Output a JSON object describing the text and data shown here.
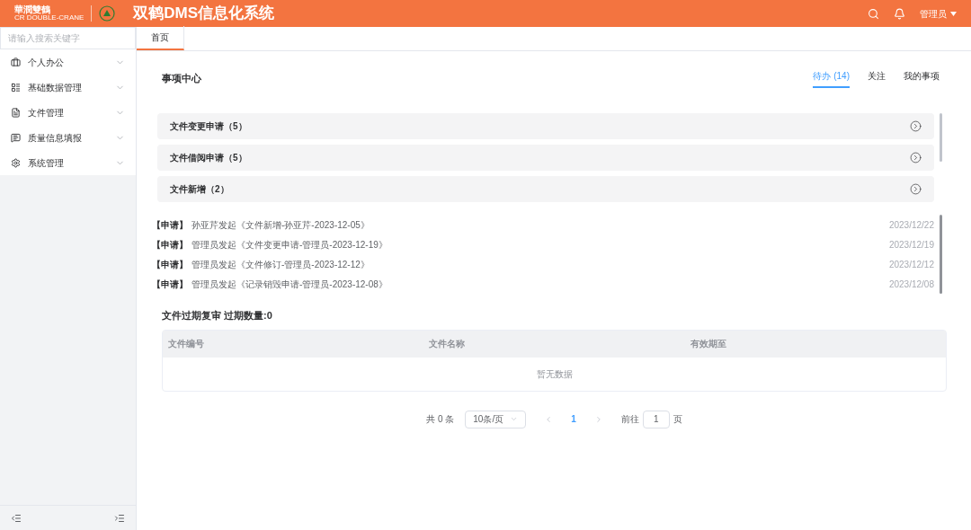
{
  "header": {
    "logo_text": "華潤雙鶴",
    "logo_subtext": "CR DOUBLE-CRANE",
    "title": "双鹤DMS信息化系统",
    "user": "管理员"
  },
  "sidebar": {
    "search": {
      "placeholder": "请输入搜索关键字"
    },
    "items": [
      {
        "label": "个人办公",
        "expanded": false
      },
      {
        "label": "基础数据管理",
        "expanded": false
      },
      {
        "label": "文件管理",
        "expanded": false
      },
      {
        "label": "质量信息填报",
        "expanded": false
      },
      {
        "label": "系统管理",
        "expanded": false
      }
    ]
  },
  "page_tabs": [
    {
      "label": "首页",
      "selected": true
    }
  ],
  "task_center": {
    "title": "事项中心",
    "tabs": [
      {
        "label": "待办 (14)",
        "selected": true
      },
      {
        "label": "关注",
        "selected": false
      },
      {
        "label": "我的事项",
        "selected": false
      }
    ],
    "groups": [
      {
        "label": "文件变更申请（5）"
      },
      {
        "label": "文件借阅申请（5）"
      },
      {
        "label": "文件新增（2）"
      }
    ],
    "items": [
      {
        "tag": "【申请】",
        "text": "孙亚芹发起《文件新增-孙亚芹-2023-12-05》",
        "date": "2023/12/22"
      },
      {
        "tag": "【申请】",
        "text": "管理员发起《文件变更申请-管理员-2023-12-19》",
        "date": "2023/12/19"
      },
      {
        "tag": "【申请】",
        "text": "管理员发起《文件修订-管理员-2023-12-12》",
        "date": "2023/12/12"
      },
      {
        "tag": "【申请】",
        "text": "管理员发起《记录销毁申请-管理员-2023-12-08》",
        "date": "2023/12/08"
      }
    ]
  },
  "expiry": {
    "title": "文件过期复审 过期数量:0",
    "table": {
      "columns": [
        "文件编号",
        "文件名称",
        "有效期至"
      ],
      "empty_text": "暂无数据"
    },
    "pagination": {
      "total": "共 0 条",
      "page_size": "10条/页",
      "pages": [
        {
          "label": "1",
          "selected": true
        }
      ],
      "goto_label": "前往",
      "goto_value": "1",
      "goto_suffix": "页"
    }
  }
}
